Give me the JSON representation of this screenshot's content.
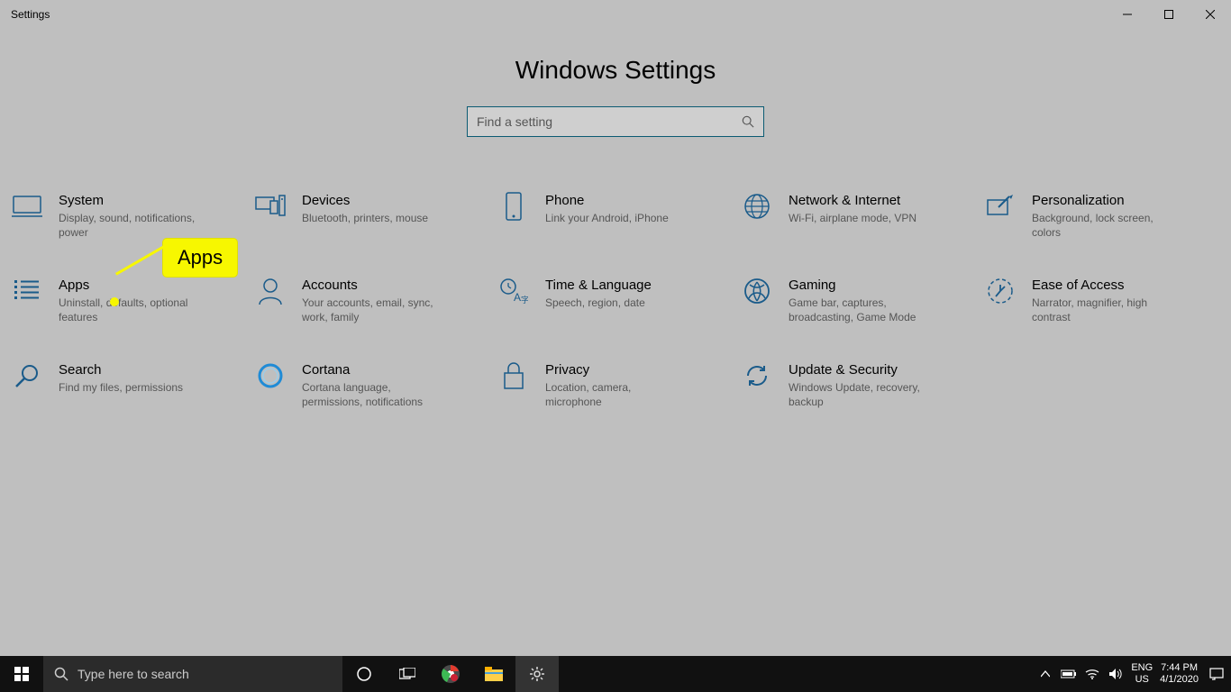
{
  "window": {
    "title": "Settings"
  },
  "page_title": "Windows Settings",
  "search": {
    "placeholder": "Find a setting"
  },
  "categories": [
    {
      "id": "system",
      "title": "System",
      "desc": "Display, sound, notifications, power"
    },
    {
      "id": "devices",
      "title": "Devices",
      "desc": "Bluetooth, printers, mouse"
    },
    {
      "id": "phone",
      "title": "Phone",
      "desc": "Link your Android, iPhone"
    },
    {
      "id": "network",
      "title": "Network & Internet",
      "desc": "Wi-Fi, airplane mode, VPN"
    },
    {
      "id": "personalization",
      "title": "Personalization",
      "desc": "Background, lock screen, colors"
    },
    {
      "id": "apps",
      "title": "Apps",
      "desc": "Uninstall, defaults, optional features"
    },
    {
      "id": "accounts",
      "title": "Accounts",
      "desc": "Your accounts, email, sync, work, family"
    },
    {
      "id": "time",
      "title": "Time & Language",
      "desc": "Speech, region, date"
    },
    {
      "id": "gaming",
      "title": "Gaming",
      "desc": "Game bar, captures, broadcasting, Game Mode"
    },
    {
      "id": "ease",
      "title": "Ease of Access",
      "desc": "Narrator, magnifier, high contrast"
    },
    {
      "id": "search",
      "title": "Search",
      "desc": "Find my files, permissions"
    },
    {
      "id": "cortana",
      "title": "Cortana",
      "desc": "Cortana language, permissions, notifications"
    },
    {
      "id": "privacy",
      "title": "Privacy",
      "desc": "Location, camera, microphone"
    },
    {
      "id": "update",
      "title": "Update & Security",
      "desc": "Windows Update, recovery, backup"
    }
  ],
  "callout": {
    "label": "Apps"
  },
  "taskbar": {
    "search_placeholder": "Type here to search",
    "lang1": "ENG",
    "lang2": "US",
    "time": "7:44 PM",
    "date": "4/1/2020"
  },
  "colors": {
    "accent": "#0b5b73",
    "icon": "#1a5b8a"
  }
}
